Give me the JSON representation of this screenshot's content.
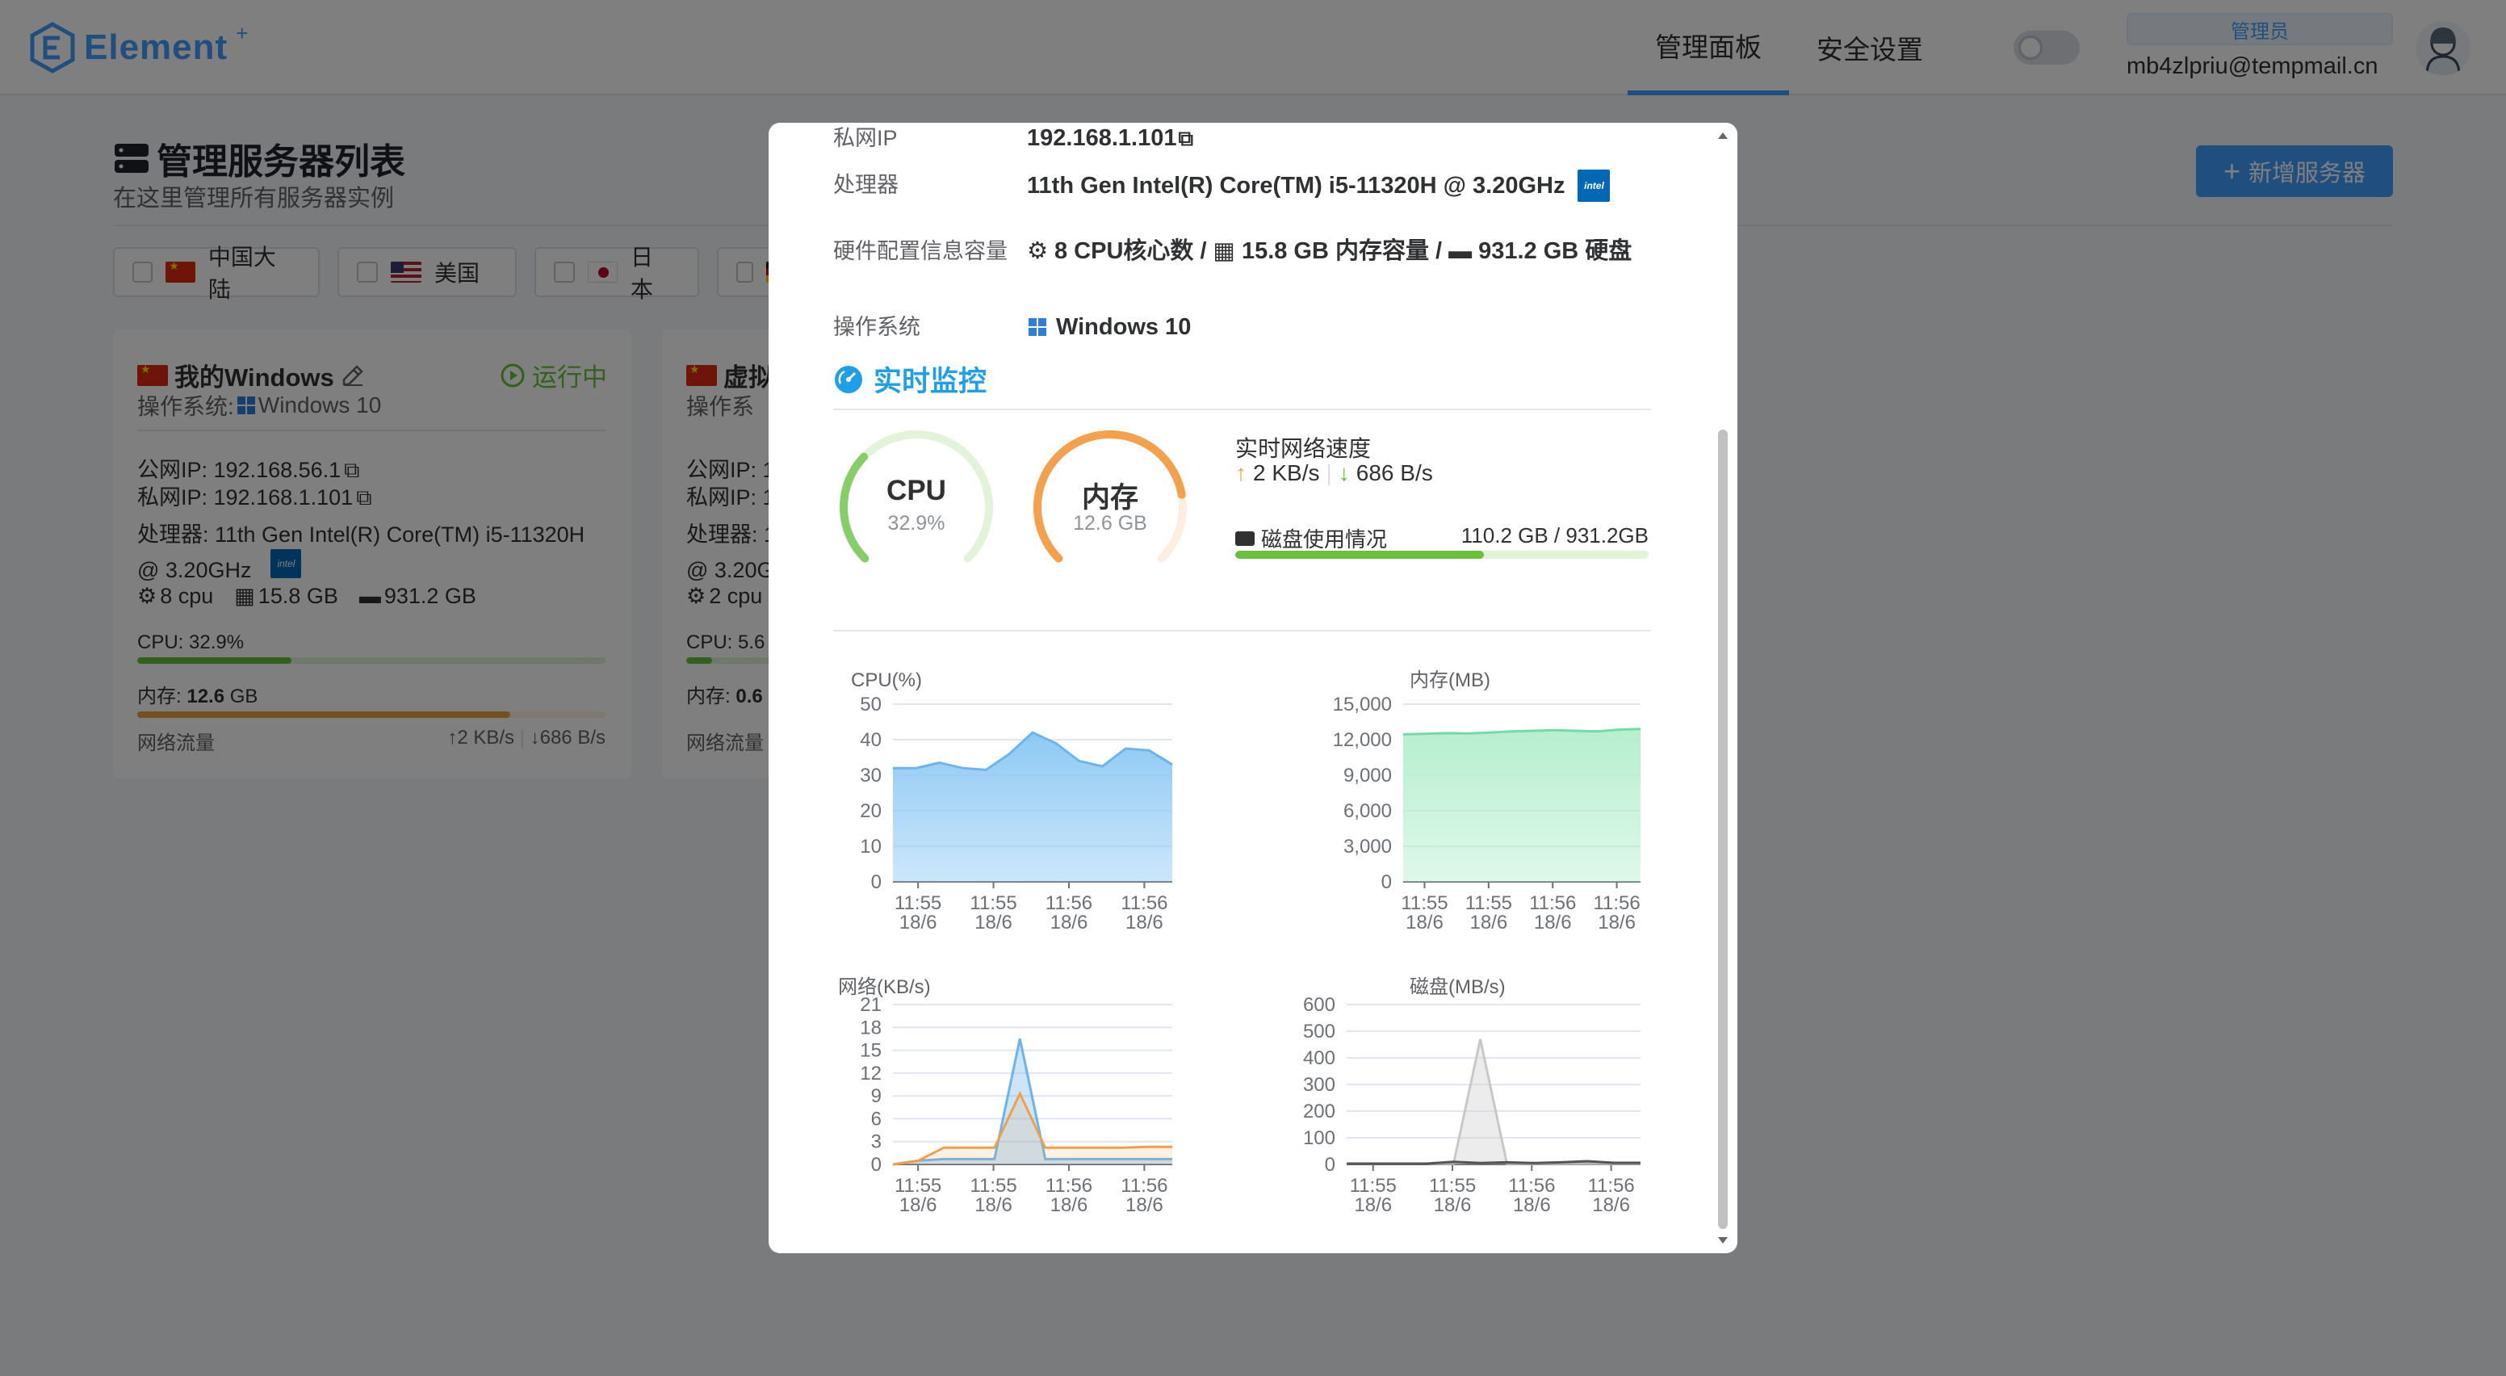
{
  "header": {
    "logo_text": "Element",
    "logo_sup": "+",
    "nav": [
      {
        "label": "管理面板",
        "active": true
      },
      {
        "label": "安全设置",
        "active": false
      }
    ],
    "role": "管理员",
    "email": "mb4zlpriu@tempmail.cn"
  },
  "page": {
    "title": "管理服务器列表",
    "subtitle": "在这里管理所有服务器实例",
    "add_button": "新增服务器",
    "regions": [
      {
        "label": "中国大陆",
        "flag": "cn"
      },
      {
        "label": "美国",
        "flag": "us"
      },
      {
        "label": "日本",
        "flag": "jp"
      },
      {
        "label": "",
        "flag": "de"
      }
    ]
  },
  "cards": [
    {
      "name": "我的Windows",
      "status": "运行中",
      "os_label": "操作系统:",
      "os": "Windows 10",
      "public_ip": "公网IP: 192.168.56.1",
      "private_ip": "私网IP: 192.168.1.101",
      "cpu_line1": "处理器: 11th Gen Intel(R) Core(TM) i5-11320H",
      "cpu_line2": "@ 3.20GHz",
      "cores": "8 cpu",
      "memory": "15.8 GB",
      "disk": "931.2 GB",
      "cpu_usage": "CPU: 32.9%",
      "cpu_fraction": 0.329,
      "mem_label": "内存:",
      "mem_usage": "12.6",
      "mem_unit": "GB",
      "mem_fraction": 0.797,
      "net_label": "网络流量",
      "net_up": "2 KB/s",
      "net_down": "686 B/s"
    },
    {
      "name": "虚拟",
      "os_label": "操作系",
      "public_ip": "公网IP: 1",
      "private_ip": "私网IP: 1",
      "cpu_line1": "处理器: 1",
      "cpu_line2": "@ 3.20G",
      "cores": "2 cpu",
      "cpu_usage": "CPU: 5.6",
      "cpu_fraction": 0.056,
      "mem_label": "内存:",
      "mem_usage": "0.6",
      "net_label": "网络流量"
    }
  ],
  "dialog": {
    "private_ip_label": "私网IP",
    "private_ip": "192.168.1.101",
    "cpu_label": "处理器",
    "cpu": "11th Gen Intel(R) Core(TM) i5-11320H @ 3.20GHz",
    "hw_label": "硬件配置信息容量",
    "hw_cores": "8 CPU核心数 /",
    "hw_memory": "15.8 GB 内存容量 /",
    "hw_disk": "931.2 GB 硬盘",
    "os_label": "操作系统",
    "os": "Windows 10",
    "monitor_title": "实时监控",
    "gauge_cpu_label": "CPU",
    "gauge_cpu_value": "32.9%",
    "gauge_cpu_fraction": 0.329,
    "gauge_mem_label": "内存",
    "gauge_mem_value": "12.6 GB",
    "gauge_mem_fraction": 0.797,
    "net_title": "实时网络速度",
    "net_up": "2 KB/s",
    "net_down": "686 B/s",
    "disk_label": "磁盘使用情况",
    "disk_value": "110.2 GB / 931.2GB",
    "disk_fraction": 0.602
  },
  "colors": {
    "primary": "#409eff",
    "success": "#67c23a",
    "warning": "#f0a04b",
    "monitor": "#1e9fe8",
    "cpu_area": "#8ec9f4",
    "mem_area": "#8fe3b4"
  },
  "chart_data": [
    {
      "type": "area",
      "title": "CPU(%)",
      "x": [
        "11:55\n18/6",
        "11:55\n18/6",
        "11:56\n18/6",
        "11:56\n18/6"
      ],
      "ylim": [
        0,
        50
      ],
      "yticks": [
        "50",
        "40",
        "30",
        "20",
        "10",
        "0"
      ],
      "series": [
        {
          "values": [
            32,
            32,
            33.5,
            32,
            31.5,
            36,
            42,
            39,
            34,
            32.5,
            37.5,
            37,
            33
          ]
        }
      ]
    },
    {
      "type": "area",
      "title": "内存(MB)",
      "x": [
        "11:55\n18/6",
        "11:55\n18/6",
        "11:56\n18/6",
        "11:56\n18/6"
      ],
      "ylim": [
        0,
        15000
      ],
      "yticks": [
        "15,000",
        "12,000",
        "9,000",
        "6,000",
        "3,000",
        "0"
      ],
      "series": [
        {
          "values": [
            12450,
            12500,
            12550,
            12530,
            12600,
            12700,
            12750,
            12800,
            12750,
            12700,
            12850,
            12900
          ]
        }
      ]
    },
    {
      "type": "area",
      "title": "网络(KB/s)",
      "x": [
        "11:55\n18/6",
        "11:55\n18/6",
        "11:56\n18/6",
        "11:56\n18/6"
      ],
      "ylim": [
        0,
        21
      ],
      "yticks": [
        "21",
        "18",
        "15",
        "12",
        "9",
        "6",
        "3",
        "0"
      ],
      "series": [
        {
          "values": [
            0,
            0.5,
            0.7,
            0.7,
            0.7,
            16.5,
            0.7,
            0.7,
            0.7,
            0.7,
            0.7,
            0.7
          ],
          "color": "#6cb4ee"
        },
        {
          "values": [
            0,
            0.5,
            2.2,
            2.2,
            2.2,
            9.3,
            2.2,
            2.2,
            2.2,
            2.2,
            2.3,
            2.3
          ],
          "color": "#f0a04b"
        }
      ]
    },
    {
      "type": "area",
      "title": "磁盘(MB/s)",
      "x": [
        "11:55\n18/6",
        "11:55\n18/6",
        "11:56\n18/6",
        "11:56\n18/6"
      ],
      "ylim": [
        0,
        600
      ],
      "yticks": [
        "600",
        "500",
        "400",
        "300",
        "200",
        "100",
        "0"
      ],
      "series": [
        {
          "values": [
            3,
            3,
            3,
            3,
            3,
            470,
            3,
            3,
            3,
            3,
            3,
            3
          ],
          "color": "#c8c8c8"
        },
        {
          "values": [
            3,
            3,
            3,
            3,
            10,
            5,
            8,
            5,
            8,
            12,
            6,
            6
          ],
          "color": "#555555"
        }
      ]
    }
  ]
}
